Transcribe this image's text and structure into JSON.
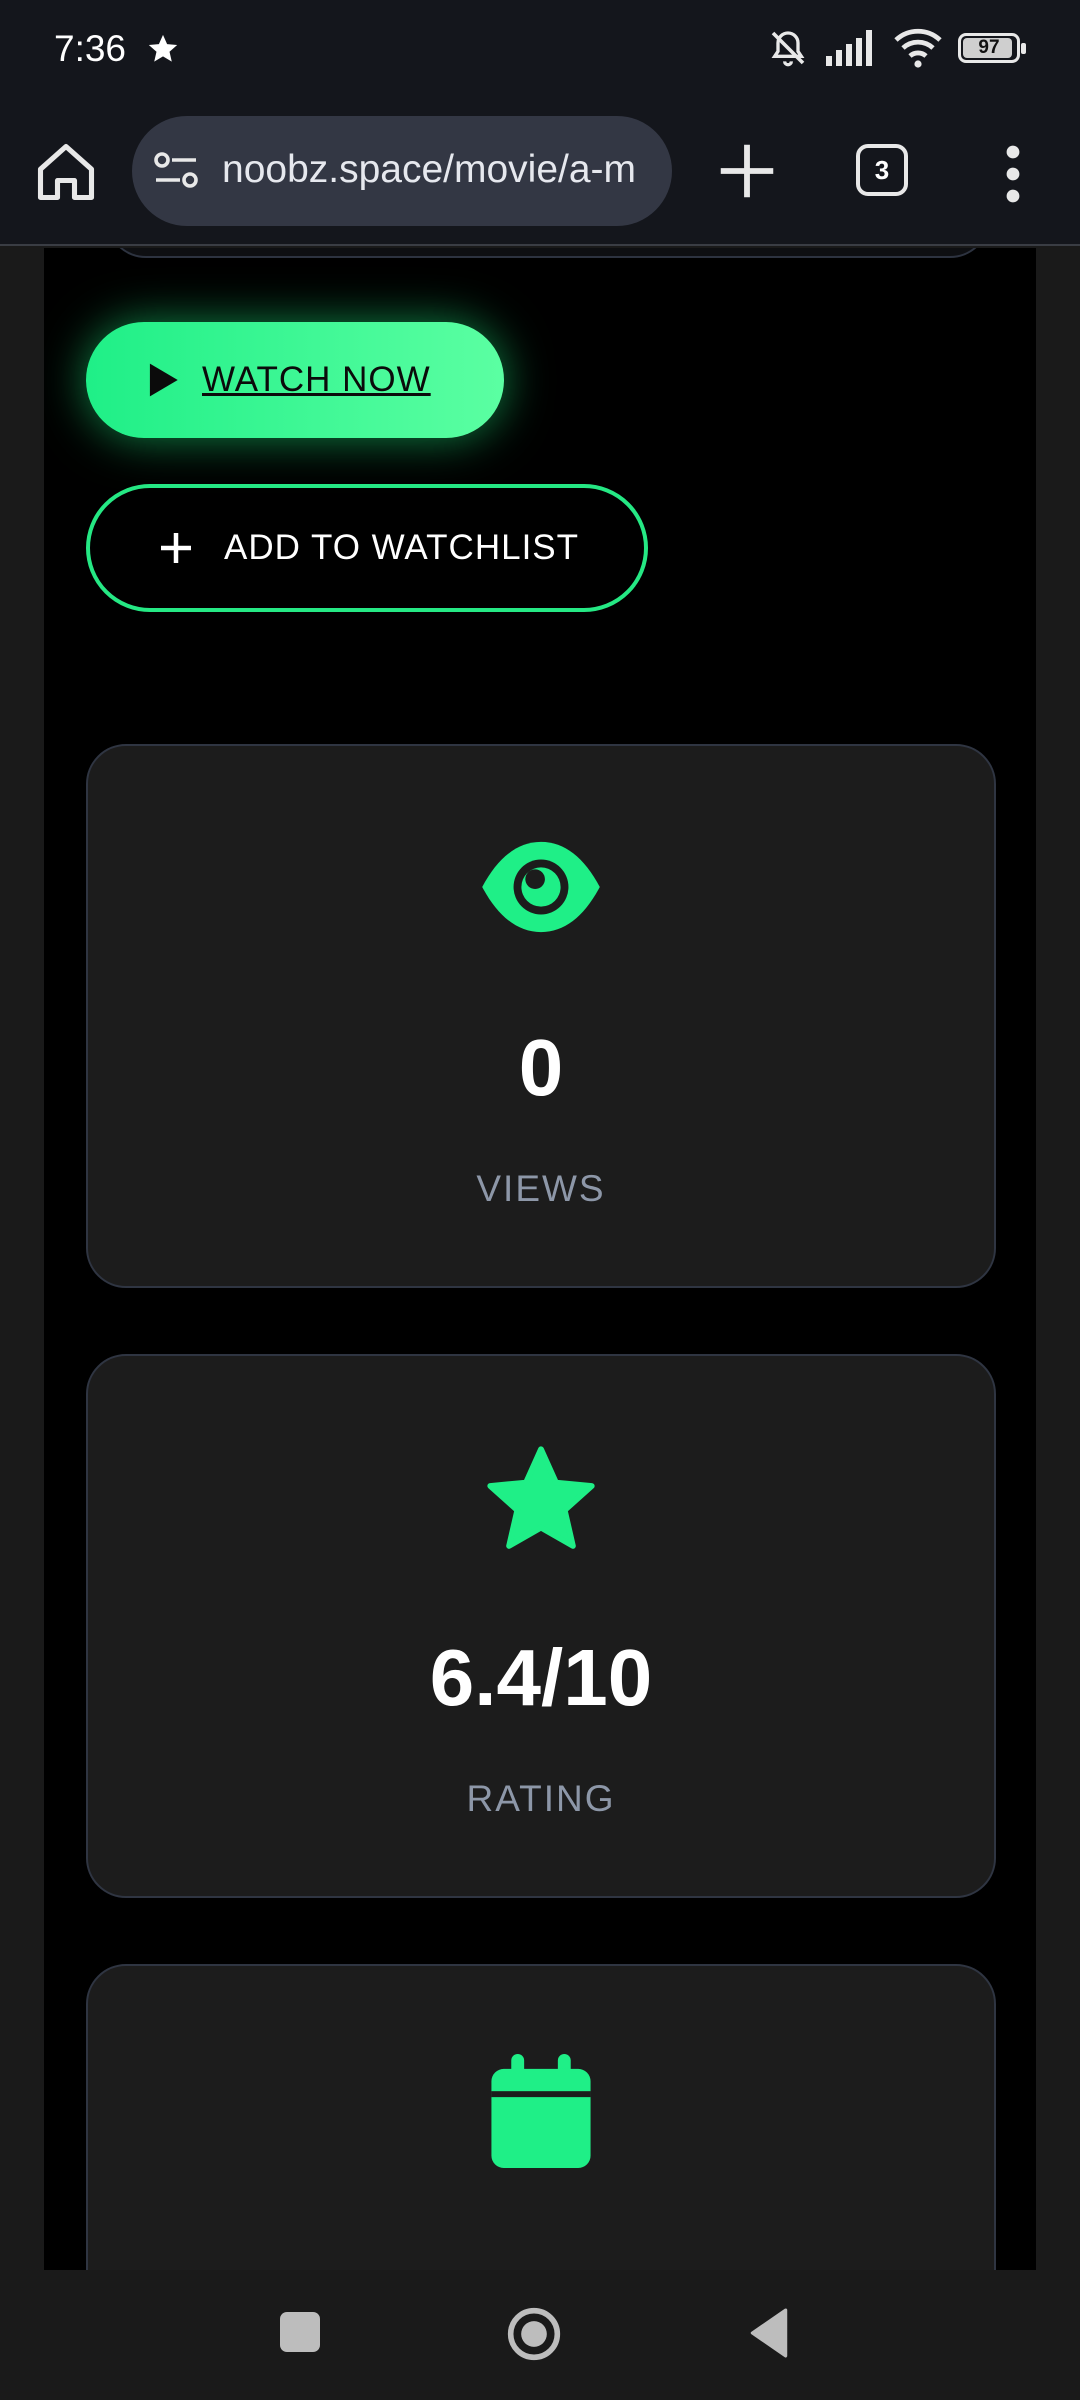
{
  "status_bar": {
    "time": "7:36",
    "battery": "97",
    "icons": [
      "star-icon",
      "mute-icon",
      "signal-icon",
      "wifi-icon",
      "battery-icon"
    ]
  },
  "browser": {
    "url": "noobz.space/movie/a-m",
    "tab_count": "3",
    "icons": [
      "home-icon",
      "site-settings-icon",
      "new-tab-icon",
      "tabs-icon",
      "menu-icon"
    ]
  },
  "actions": {
    "watch_now": "WATCH NOW",
    "add_watchlist": "ADD TO WATCHLIST"
  },
  "stats": [
    {
      "icon": "eye-icon",
      "value": "0",
      "label": "VIEWS"
    },
    {
      "icon": "star-icon",
      "value": "6.4/10",
      "label": "RATING"
    },
    {
      "icon": "calendar-icon",
      "value": "",
      "label": ""
    }
  ],
  "colors": {
    "accent": "#1fef87",
    "background": "#000000",
    "card": "#1c1c1c",
    "muted_text": "#8d97a8"
  }
}
